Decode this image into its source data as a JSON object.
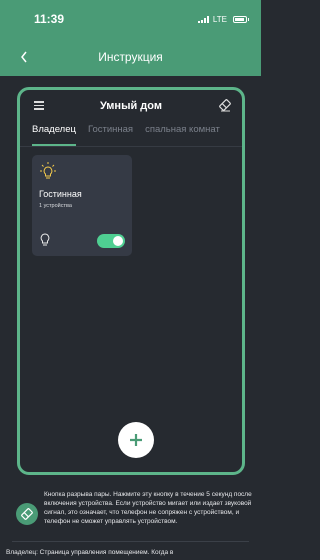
{
  "status_bar": {
    "time": "11:39",
    "network": "LTE"
  },
  "nav": {
    "title": "Инструкция",
    "back_icon": "chevron-left-icon"
  },
  "app": {
    "title": "Умный дом",
    "menu_icon": "menu-icon",
    "eraser_icon": "eraser-icon",
    "tabs": [
      {
        "label": "Владелец",
        "active": true
      },
      {
        "label": "Гостинная",
        "active": false
      },
      {
        "label": "спальная комнат",
        "active": false
      }
    ],
    "room_card": {
      "title": "Гостинная",
      "subtitle": "1 устройства",
      "toggle_on": true
    }
  },
  "info": {
    "text": "Кнопка разрыва пары. Нажмите эту кнопку в течение 5 секунд после включения устройства. Если устройство мигает или издает звуковой сигнал, это означает, что телефон не сопряжен с устройством, и телефон не сможет управлять устройством.",
    "text2": "Владелец: Страница управления помещением. Когда в"
  },
  "colors": {
    "accent": "#4a9b76",
    "frame_border": "#5db58a",
    "toggle": "#4fcf92",
    "background": "#262a30",
    "card": "#353a45"
  }
}
